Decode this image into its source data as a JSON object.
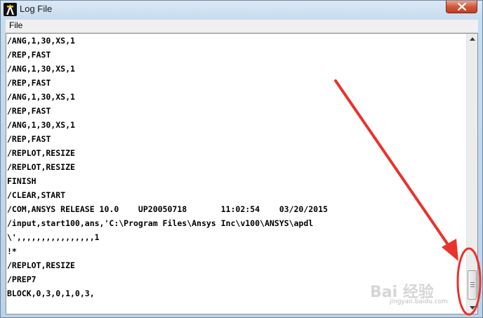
{
  "window": {
    "title": "Log File",
    "icon": "ansys-logo-icon",
    "close_icon": "close-icon"
  },
  "menu": {
    "file_label": "File"
  },
  "log": {
    "lines": [
      "/ANG,1,30,XS,1",
      "/REP,FAST",
      "/ANG,1,30,XS,1",
      "/REP,FAST",
      "/ANG,1,30,XS,1",
      "/REP,FAST",
      "/ANG,1,30,XS,1",
      "/REP,FAST",
      "/REPLOT,RESIZE",
      "/REPLOT,RESIZE",
      "FINISH",
      "/CLEAR,START",
      "/COM,ANSYS RELEASE 10.0    UP20050718       11:02:54    03/20/2015",
      "/input,start100,ans,'C:\\Program Files\\Ansys Inc\\v100\\ANSYS\\apdl",
      "\\',,,,,,,,,,,,,,,,1",
      "!*",
      "/REPLOT,RESIZE",
      "/PREP7",
      "BLOCK,0,3,0,1,0,3,"
    ]
  },
  "scrollbar": {
    "position_fraction": 0.92
  },
  "watermark": {
    "brand": "Bai 经验",
    "url": "jingyan.baidu.com"
  },
  "colors": {
    "annotation": "#e8332c",
    "close_button": "#d4573a"
  }
}
